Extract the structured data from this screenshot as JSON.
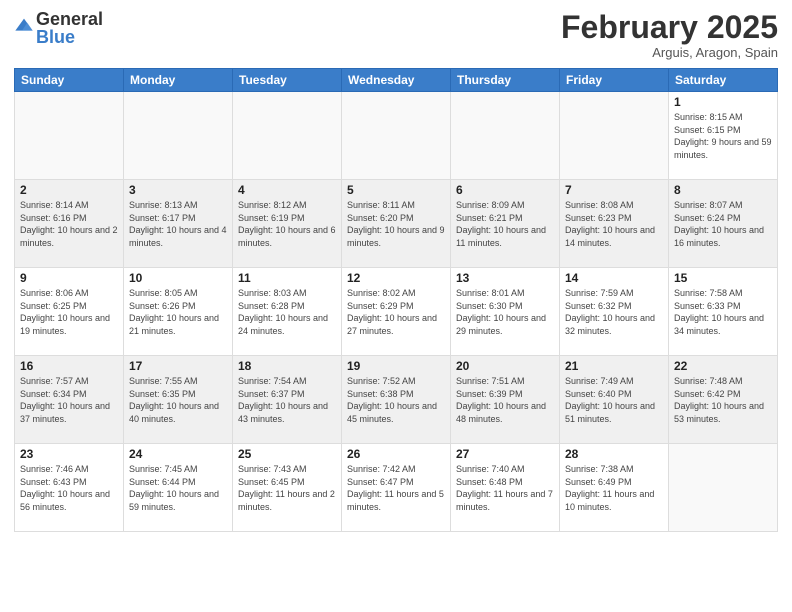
{
  "logo": {
    "text_general": "General",
    "text_blue": "Blue"
  },
  "header": {
    "month_title": "February 2025",
    "subtitle": "Arguis, Aragon, Spain"
  },
  "weekdays": [
    "Sunday",
    "Monday",
    "Tuesday",
    "Wednesday",
    "Thursday",
    "Friday",
    "Saturday"
  ],
  "weeks": [
    {
      "shaded": false,
      "days": [
        {
          "date": "",
          "info": ""
        },
        {
          "date": "",
          "info": ""
        },
        {
          "date": "",
          "info": ""
        },
        {
          "date": "",
          "info": ""
        },
        {
          "date": "",
          "info": ""
        },
        {
          "date": "",
          "info": ""
        },
        {
          "date": "1",
          "info": "Sunrise: 8:15 AM\nSunset: 6:15 PM\nDaylight: 9 hours and 59 minutes."
        }
      ]
    },
    {
      "shaded": true,
      "days": [
        {
          "date": "2",
          "info": "Sunrise: 8:14 AM\nSunset: 6:16 PM\nDaylight: 10 hours and 2 minutes."
        },
        {
          "date": "3",
          "info": "Sunrise: 8:13 AM\nSunset: 6:17 PM\nDaylight: 10 hours and 4 minutes."
        },
        {
          "date": "4",
          "info": "Sunrise: 8:12 AM\nSunset: 6:19 PM\nDaylight: 10 hours and 6 minutes."
        },
        {
          "date": "5",
          "info": "Sunrise: 8:11 AM\nSunset: 6:20 PM\nDaylight: 10 hours and 9 minutes."
        },
        {
          "date": "6",
          "info": "Sunrise: 8:09 AM\nSunset: 6:21 PM\nDaylight: 10 hours and 11 minutes."
        },
        {
          "date": "7",
          "info": "Sunrise: 8:08 AM\nSunset: 6:23 PM\nDaylight: 10 hours and 14 minutes."
        },
        {
          "date": "8",
          "info": "Sunrise: 8:07 AM\nSunset: 6:24 PM\nDaylight: 10 hours and 16 minutes."
        }
      ]
    },
    {
      "shaded": false,
      "days": [
        {
          "date": "9",
          "info": "Sunrise: 8:06 AM\nSunset: 6:25 PM\nDaylight: 10 hours and 19 minutes."
        },
        {
          "date": "10",
          "info": "Sunrise: 8:05 AM\nSunset: 6:26 PM\nDaylight: 10 hours and 21 minutes."
        },
        {
          "date": "11",
          "info": "Sunrise: 8:03 AM\nSunset: 6:28 PM\nDaylight: 10 hours and 24 minutes."
        },
        {
          "date": "12",
          "info": "Sunrise: 8:02 AM\nSunset: 6:29 PM\nDaylight: 10 hours and 27 minutes."
        },
        {
          "date": "13",
          "info": "Sunrise: 8:01 AM\nSunset: 6:30 PM\nDaylight: 10 hours and 29 minutes."
        },
        {
          "date": "14",
          "info": "Sunrise: 7:59 AM\nSunset: 6:32 PM\nDaylight: 10 hours and 32 minutes."
        },
        {
          "date": "15",
          "info": "Sunrise: 7:58 AM\nSunset: 6:33 PM\nDaylight: 10 hours and 34 minutes."
        }
      ]
    },
    {
      "shaded": true,
      "days": [
        {
          "date": "16",
          "info": "Sunrise: 7:57 AM\nSunset: 6:34 PM\nDaylight: 10 hours and 37 minutes."
        },
        {
          "date": "17",
          "info": "Sunrise: 7:55 AM\nSunset: 6:35 PM\nDaylight: 10 hours and 40 minutes."
        },
        {
          "date": "18",
          "info": "Sunrise: 7:54 AM\nSunset: 6:37 PM\nDaylight: 10 hours and 43 minutes."
        },
        {
          "date": "19",
          "info": "Sunrise: 7:52 AM\nSunset: 6:38 PM\nDaylight: 10 hours and 45 minutes."
        },
        {
          "date": "20",
          "info": "Sunrise: 7:51 AM\nSunset: 6:39 PM\nDaylight: 10 hours and 48 minutes."
        },
        {
          "date": "21",
          "info": "Sunrise: 7:49 AM\nSunset: 6:40 PM\nDaylight: 10 hours and 51 minutes."
        },
        {
          "date": "22",
          "info": "Sunrise: 7:48 AM\nSunset: 6:42 PM\nDaylight: 10 hours and 53 minutes."
        }
      ]
    },
    {
      "shaded": false,
      "days": [
        {
          "date": "23",
          "info": "Sunrise: 7:46 AM\nSunset: 6:43 PM\nDaylight: 10 hours and 56 minutes."
        },
        {
          "date": "24",
          "info": "Sunrise: 7:45 AM\nSunset: 6:44 PM\nDaylight: 10 hours and 59 minutes."
        },
        {
          "date": "25",
          "info": "Sunrise: 7:43 AM\nSunset: 6:45 PM\nDaylight: 11 hours and 2 minutes."
        },
        {
          "date": "26",
          "info": "Sunrise: 7:42 AM\nSunset: 6:47 PM\nDaylight: 11 hours and 5 minutes."
        },
        {
          "date": "27",
          "info": "Sunrise: 7:40 AM\nSunset: 6:48 PM\nDaylight: 11 hours and 7 minutes."
        },
        {
          "date": "28",
          "info": "Sunrise: 7:38 AM\nSunset: 6:49 PM\nDaylight: 11 hours and 10 minutes."
        },
        {
          "date": "",
          "info": ""
        }
      ]
    }
  ]
}
